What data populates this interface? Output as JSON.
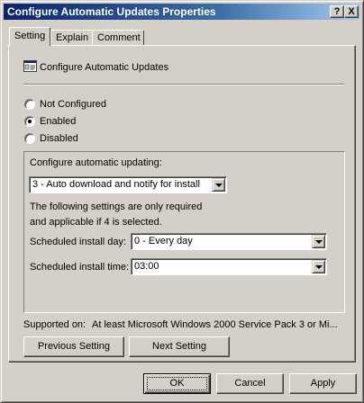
{
  "window": {
    "title": "Configure Automatic Updates Properties",
    "help_button": "?",
    "close_button": "X"
  },
  "tabs": [
    {
      "label": "Setting",
      "active": true
    },
    {
      "label": "Explain",
      "active": false
    },
    {
      "label": "Comment",
      "active": false
    }
  ],
  "policy": {
    "title": "Configure Automatic Updates",
    "icon": "policy-setting-icon"
  },
  "state_options": [
    {
      "label": "Not Configured",
      "selected": false
    },
    {
      "label": "Enabled",
      "selected": true
    },
    {
      "label": "Disabled",
      "selected": false
    }
  ],
  "options": {
    "configure_label": "Configure automatic updating:",
    "configure_value": "3 - Auto download and notify for install",
    "note_line1": "The following settings are only required",
    "note_line2": "and applicable if 4 is selected.",
    "install_day_label": "Scheduled install day:",
    "install_day_value": "0 - Every day",
    "install_time_label": "Scheduled install time:",
    "install_time_value": "03:00"
  },
  "supported": {
    "label": "Supported on:",
    "value": "At least Microsoft Windows 2000 Service Pack 3 or Mi..."
  },
  "nav_buttons": {
    "previous": "Previous Setting",
    "next": "Next Setting"
  },
  "dialog_buttons": {
    "ok": "OK",
    "cancel": "Cancel",
    "apply": "Apply"
  },
  "colors": {
    "face": "#d4d0c8",
    "title_start": "#0a246a",
    "title_end": "#a6caf0"
  }
}
